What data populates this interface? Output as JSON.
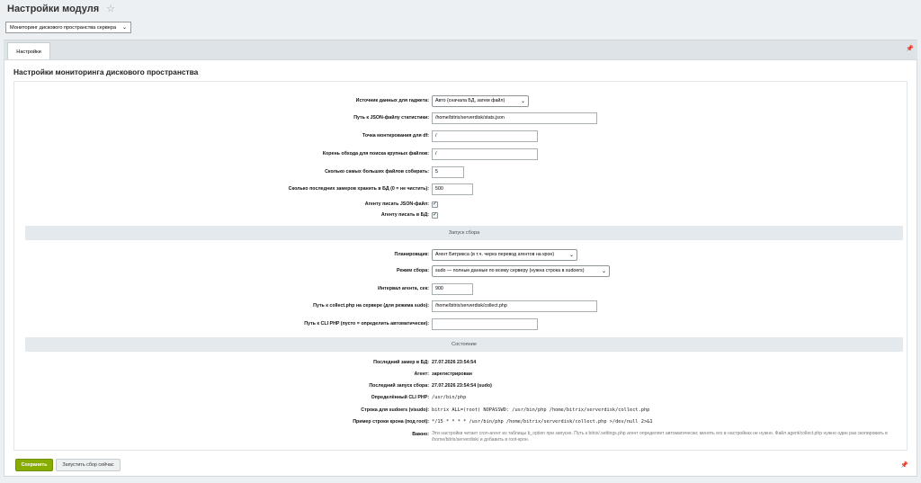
{
  "header": {
    "title": "Настройки модуля",
    "module_select": "Мониторинг дискового пространства сервера"
  },
  "tabs": [
    {
      "label": "Настройки"
    }
  ],
  "panel": {
    "title": "Настройки мониторинга дискового пространства"
  },
  "settings": {
    "source": {
      "label": "Источник данных для гаджета:",
      "value": "Авто (сначала БД, затем файл)"
    },
    "json_path": {
      "label": "Путь к JSON-файлу статистики:",
      "value": "/home/bitrix/serverdisk/stats.json"
    },
    "mount": {
      "label": "Точка монтирования для df:",
      "value": "/"
    },
    "root": {
      "label": "Корень обхода для поиска крупных файлов:",
      "value": "/"
    },
    "top_files": {
      "label": "Сколько самых больших файлов собирать:",
      "value": "5"
    },
    "keep": {
      "label": "Сколько последних замеров хранить в БД (0 = не чистить):",
      "value": "500"
    },
    "agent_json": {
      "label": "Агенту писать JSON-файл:",
      "checked": true
    },
    "agent_db": {
      "label": "Агенту писать в БД:",
      "checked": true
    }
  },
  "sections": {
    "collect": "Запуск сбора",
    "state": "Состояние"
  },
  "collect": {
    "scheduler": {
      "label": "Планировщик:",
      "value": "Агент Битрикса (в т.ч. через перевод агентов на крон)"
    },
    "mode": {
      "label": "Режим сбора:",
      "value": "sudo — полные данные по всему серверу (нужна строка в sudoers)"
    },
    "interval": {
      "label": "Интервал агента, сек:",
      "value": "900"
    },
    "collect_path": {
      "label": "Путь к collect.php на сервере (для режима sudo):",
      "value": "/home/bitrix/serverdisk/collect.php"
    },
    "cli_php": {
      "label": "Путь к CLI PHP (пусто = определить автоматически):",
      "value": ""
    }
  },
  "state": {
    "last_measure": {
      "label": "Последний замер в БД:",
      "value": "27.07.2026 23:54:54"
    },
    "agent": {
      "label": "Агент:",
      "value": "зарегистрирован"
    },
    "last_run": {
      "label": "Последний запуск сбора:",
      "value": "27.07.2026 23:54:54 (sudo)"
    },
    "cli": {
      "label": "Определённый CLI PHP:",
      "value": "/usr/bin/php"
    },
    "sudoers": {
      "label": "Строка для sudoers (visudo):",
      "value": "bitrix ALL=(root) NOPASSWD: /usr/bin/php /home/bitrix/serverdisk/collect.php"
    },
    "cron": {
      "label": "Пример строки крона (под root):",
      "value": "*/15 * * * * /usr/bin/php /home/bitrix/serverdisk/collect.php >/dev/null 2>&1"
    },
    "important": {
      "label": "Важно:",
      "value": "Эти настройки читает cron-агент из таблицы b_option при запуске. Путь к bitrix/.settings.php агент определяет автоматически; менять его в настройках не нужно. Файл agent/collect.php нужно один раз скопировать в /home/bitrix/serverdisk/ и добавить в root-крон."
    }
  },
  "buttons": {
    "save": "Сохранить",
    "run": "Запустить сбор сейчас"
  },
  "icons": {
    "star": "star-icon",
    "pin": "pin-icon",
    "check": "✓",
    "chevron": "⌄"
  }
}
